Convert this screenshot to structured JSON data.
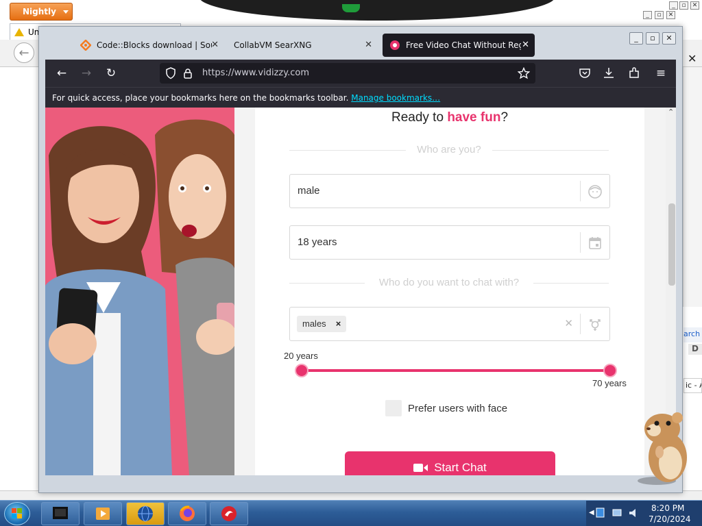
{
  "background_window": {
    "menu_button": "Nightly",
    "tab_title": "Unt"
  },
  "tabs": [
    {
      "title": "Code::Blocks download | Source",
      "close": "✕"
    },
    {
      "title": "CollabVM SearXNG",
      "close": "✕"
    },
    {
      "title": "Free Video Chat Without Regist",
      "close": "✕",
      "active": true
    }
  ],
  "navbar": {
    "url": "https://www.vidizzy.com"
  },
  "bookmarks_bar": {
    "message": "For quick access, place your bookmarks here on the bookmarks toolbar.",
    "link": "Manage bookmarks…"
  },
  "form": {
    "heading_prefix": "Ready to ",
    "heading_accent": "have fun",
    "heading_suffix": "?",
    "section_you": "Who are you?",
    "gender_value": "male",
    "age_value": "18 years",
    "section_chat_with": "Who do you want to chat with?",
    "target_tag": "males",
    "target_tag_remove": "×",
    "clear": "✕",
    "age_min_label": "20 years",
    "age_max_label": "70 years",
    "age_range": {
      "min": 20,
      "max": 70,
      "min_fraction": 0.0,
      "max_fraction": 1.0
    },
    "prefer_face_label": "Prefer users with face",
    "prefer_face_checked": false,
    "start_button": "Start Chat"
  },
  "background_fragments": {
    "search_fragment": "arch",
    "d_fragment": "D",
    "ic_fragment": "ic - A"
  },
  "taskbar": {
    "time": "8:20 PM",
    "date": "7/20/2024"
  },
  "colors": {
    "accent_pink": "#e8336d",
    "firefox_dark": "#2b2a33",
    "link_cyan": "#00ddff",
    "nightly_orange": "#e66f12"
  }
}
